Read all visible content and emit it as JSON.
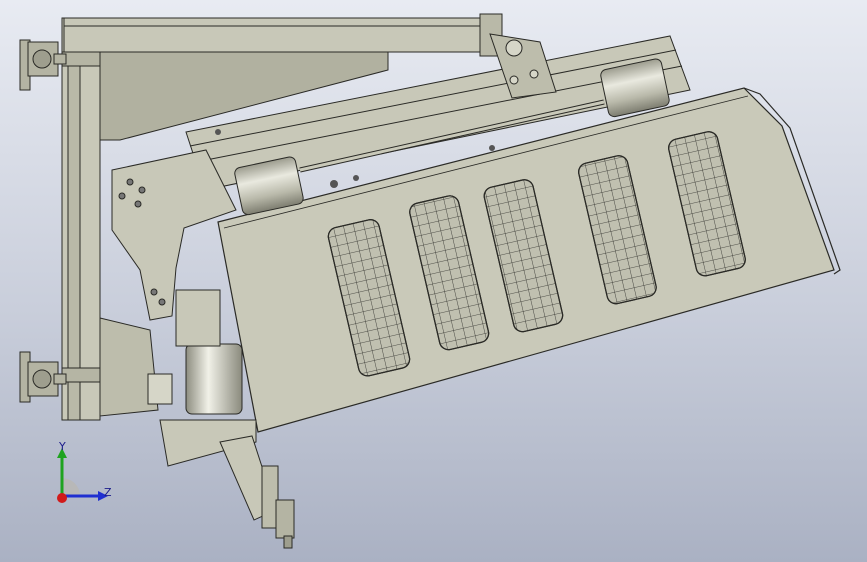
{
  "colors": {
    "bg_top": "#e8ebf2",
    "bg_bottom": "#aab1c3",
    "part_fill": "#c8c8b8",
    "part_dark": "#a9a996",
    "edge": "#2a2a26",
    "axis_x": "#d11a1a",
    "axis_y": "#1fa31f",
    "axis_z": "#1f2fd1"
  },
  "triad": {
    "y_label": "Y",
    "z_label": "Z"
  },
  "icons": {
    "triad": "coordinate-triad-icon",
    "model": "cad-assembly-icon"
  }
}
